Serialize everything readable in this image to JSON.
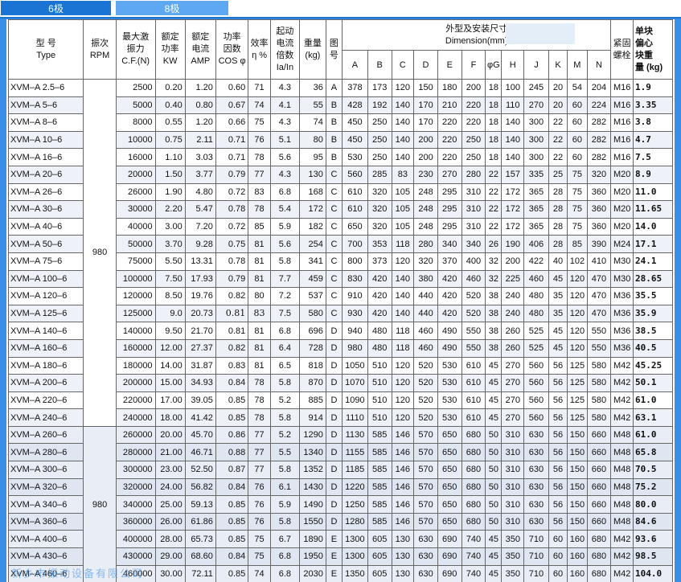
{
  "tabs": [
    {
      "label": "6极"
    },
    {
      "label": "8极"
    }
  ],
  "headers": {
    "type": "型 号\nType",
    "rpm": "振次\nRPM",
    "force": "最大激\n振力\nC.F.(N)",
    "power": "额定\n功率\nKW",
    "current": "额定\n电流\nAMP",
    "cos": "功率\n因数\nCOS φ",
    "eff": "效率\nη %",
    "start": "起动\n电流\n倍数\nIa/In",
    "weight": "重量\n(kg)",
    "fig": "图\n号",
    "dim_title": "外型及安装尺寸\nDimension(mm)",
    "dims": [
      "A",
      "B",
      "C",
      "D",
      "E",
      "F",
      "φG",
      "H",
      "J",
      "K",
      "M",
      "N"
    ],
    "bolt": "紧固\n螺栓",
    "unit_weight": "单块\n偏心\n块重\n量 (kg)"
  },
  "rpm_value": "980",
  "rows": [
    {
      "type": "XVM–A   2.5–6",
      "force": "2500",
      "power": "0.20",
      "current": "1.20",
      "cos": "0.60",
      "eff": "71",
      "start": "4.3",
      "weight": "36",
      "fig": "A",
      "dims": [
        "378",
        "173",
        "120",
        "150",
        "180",
        "200",
        "18",
        "100",
        "245",
        "20",
        "54",
        "204"
      ],
      "bolt": "M16",
      "w": "1.9"
    },
    {
      "type": "XVM–A     5–6",
      "force": "5000",
      "power": "0.40",
      "current": "0.80",
      "cos": "0.67",
      "eff": "74",
      "start": "4.1",
      "weight": "55",
      "fig": "B",
      "dims": [
        "428",
        "192",
        "140",
        "170",
        "210",
        "220",
        "18",
        "110",
        "270",
        "20",
        "60",
        "224"
      ],
      "bolt": "M16",
      "w": "3.35"
    },
    {
      "type": "XVM–A     8–6",
      "force": "8000",
      "power": "0.55",
      "current": "1.20",
      "cos": "0.66",
      "eff": "75",
      "start": "4.3",
      "weight": "74",
      "fig": "B",
      "dims": [
        "450",
        "250",
        "140",
        "170",
        "220",
        "220",
        "18",
        "140",
        "300",
        "22",
        "60",
        "282"
      ],
      "bolt": "M16",
      "w": "3.8"
    },
    {
      "type": "XVM–A    10–6",
      "force": "10000",
      "power": "0.75",
      "current": "2.11",
      "cos": "0.71",
      "eff": "76",
      "start": "5.1",
      "weight": "80",
      "fig": "B",
      "dims": [
        "450",
        "250",
        "140",
        "200",
        "220",
        "250",
        "18",
        "140",
        "300",
        "22",
        "60",
        "282"
      ],
      "bolt": "M16",
      "w": "4.7"
    },
    {
      "type": "XVM–A    16–6",
      "force": "16000",
      "power": "1.10",
      "current": "3.03",
      "cos": "0.71",
      "eff": "78",
      "start": "5.6",
      "weight": "95",
      "fig": "B",
      "dims": [
        "530",
        "250",
        "140",
        "200",
        "220",
        "250",
        "18",
        "140",
        "300",
        "22",
        "60",
        "282"
      ],
      "bolt": "M16",
      "w": "7.5"
    },
    {
      "type": "XVM–A    20–6",
      "force": "20000",
      "power": "1.50",
      "current": "3.77",
      "cos": "0.79",
      "eff": "77",
      "start": "4.3",
      "weight": "130",
      "fig": "C",
      "dims": [
        "560",
        "285",
        "83",
        "230",
        "270",
        "280",
        "22",
        "157",
        "335",
        "25",
        "75",
        "320"
      ],
      "bolt": "M20",
      "w": "8.9"
    },
    {
      "type": "XVM–A    26–6",
      "force": "26000",
      "power": "1.90",
      "current": "4.80",
      "cos": "0.72",
      "eff": "83",
      "start": "6.8",
      "weight": "168",
      "fig": "C",
      "dims": [
        "610",
        "320",
        "105",
        "248",
        "295",
        "310",
        "22",
        "172",
        "365",
        "28",
        "75",
        "360"
      ],
      "bolt": "M20",
      "w": "11.0"
    },
    {
      "type": "XVM–A    30–6",
      "force": "30000",
      "power": "2.20",
      "current": "5.47",
      "cos": "0.78",
      "eff": "78",
      "start": "5.4",
      "weight": "172",
      "fig": "C",
      "dims": [
        "610",
        "320",
        "105",
        "248",
        "295",
        "310",
        "22",
        "172",
        "365",
        "28",
        "75",
        "360"
      ],
      "bolt": "M20",
      "w": "11.65"
    },
    {
      "type": "XVM–A    40–6",
      "force": "40000",
      "power": "3.00",
      "current": "7.20",
      "cos": "0.72",
      "eff": "85",
      "start": "5.9",
      "weight": "182",
      "fig": "C",
      "dims": [
        "650",
        "320",
        "105",
        "248",
        "295",
        "310",
        "22",
        "172",
        "365",
        "28",
        "75",
        "360"
      ],
      "bolt": "M20",
      "w": "14.0"
    },
    {
      "type": "XVM–A    50–6",
      "force": "50000",
      "power": "3.70",
      "current": "9.28",
      "cos": "0.75",
      "eff": "81",
      "start": "5.6",
      "weight": "254",
      "fig": "C",
      "dims": [
        "700",
        "353",
        "118",
        "280",
        "340",
        "340",
        "26",
        "190",
        "406",
        "28",
        "85",
        "390"
      ],
      "bolt": "M24",
      "w": "17.1"
    },
    {
      "type": "XVM–A    75–6",
      "force": "75000",
      "power": "5.50",
      "current": "13.31",
      "cos": "0.78",
      "eff": "81",
      "start": "5.8",
      "weight": "341",
      "fig": "C",
      "dims": [
        "800",
        "373",
        "120",
        "320",
        "370",
        "400",
        "32",
        "200",
        "422",
        "40",
        "102",
        "410"
      ],
      "bolt": "M30",
      "w": "24.1"
    },
    {
      "type": "XVM–A   100–6",
      "force": "100000",
      "power": "7.50",
      "current": "17.93",
      "cos": "0.79",
      "eff": "81",
      "start": "7.7",
      "weight": "459",
      "fig": "C",
      "dims": [
        "830",
        "420",
        "140",
        "380",
        "420",
        "460",
        "32",
        "225",
        "460",
        "45",
        "120",
        "470"
      ],
      "bolt": "M30",
      "w": "28.65"
    },
    {
      "type": "XVM–A   120–6",
      "force": "120000",
      "power": "8.50",
      "current": "19.76",
      "cos": "0.82",
      "eff": "80",
      "start": "7.2",
      "weight": "537",
      "fig": "C",
      "dims": [
        "910",
        "420",
        "140",
        "440",
        "420",
        "520",
        "38",
        "240",
        "480",
        "35",
        "120",
        "470"
      ],
      "bolt": "M36",
      "w": "35.5"
    },
    {
      "type": "XVM–A   125–6",
      "force": "125000",
      "power": "9.0",
      "current": "20.73",
      "cos": "0.81",
      "eff": "83",
      "start": "7.5",
      "weight": "580",
      "fig": "C",
      "dims": [
        "930",
        "420",
        "140",
        "440",
        "420",
        "520",
        "38",
        "240",
        "480",
        "35",
        "120",
        "470"
      ],
      "bolt": "M36",
      "w": "35.9",
      "serif": true
    },
    {
      "type": "XVM–A   140–6",
      "force": "140000",
      "power": "9.50",
      "current": "21.70",
      "cos": "0.81",
      "eff": "81",
      "start": "6.8",
      "weight": "696",
      "fig": "D",
      "dims": [
        "940",
        "480",
        "118",
        "460",
        "490",
        "550",
        "38",
        "260",
        "525",
        "45",
        "120",
        "550"
      ],
      "bolt": "M36",
      "w": "38.5"
    },
    {
      "type": "XVM–A   160–6",
      "force": "160000",
      "power": "12.00",
      "current": "27.37",
      "cos": "0.82",
      "eff": "81",
      "start": "6.4",
      "weight": "728",
      "fig": "D",
      "dims": [
        "980",
        "480",
        "118",
        "460",
        "490",
        "550",
        "38",
        "260",
        "525",
        "45",
        "120",
        "550"
      ],
      "bolt": "M36",
      "w": "40.5"
    },
    {
      "type": "XVM–A   180–6",
      "force": "180000",
      "power": "14.00",
      "current": "31.87",
      "cos": "0.83",
      "eff": "81",
      "start": "6.5",
      "weight": "818",
      "fig": "D",
      "dims": [
        "1050",
        "510",
        "120",
        "520",
        "530",
        "610",
        "45",
        "270",
        "560",
        "56",
        "125",
        "580"
      ],
      "bolt": "M42",
      "w": "45.25"
    },
    {
      "type": "XVM–A   200–6",
      "force": "200000",
      "power": "15.00",
      "current": "34.93",
      "cos": "0.84",
      "eff": "78",
      "start": "5.8",
      "weight": "870",
      "fig": "D",
      "dims": [
        "1070",
        "510",
        "120",
        "520",
        "530",
        "610",
        "45",
        "270",
        "560",
        "56",
        "125",
        "580"
      ],
      "bolt": "M42",
      "w": "50.1"
    },
    {
      "type": "XVM–A   220–6",
      "force": "220000",
      "power": "17.00",
      "current": "39.05",
      "cos": "0.85",
      "eff": "78",
      "start": "5.2",
      "weight": "885",
      "fig": "D",
      "dims": [
        "1090",
        "510",
        "120",
        "520",
        "530",
        "610",
        "45",
        "270",
        "560",
        "56",
        "125",
        "580"
      ],
      "bolt": "M42",
      "w": "61.0"
    },
    {
      "type": "XVM–A   240–6",
      "force": "240000",
      "power": "18.00",
      "current": "41.42",
      "cos": "0.85",
      "eff": "78",
      "start": "5.8",
      "weight": "914",
      "fig": "D",
      "dims": [
        "1110",
        "510",
        "120",
        "520",
        "530",
        "610",
        "45",
        "270",
        "560",
        "56",
        "125",
        "580"
      ],
      "bolt": "M42",
      "w": "63.1"
    },
    {
      "type": "XVM–A   260–6",
      "force": "260000",
      "power": "20.00",
      "current": "45.70",
      "cos": "0.86",
      "eff": "77",
      "start": "5.2",
      "weight": "1290",
      "fig": "D",
      "dims": [
        "1130",
        "585",
        "146",
        "570",
        "650",
        "680",
        "50",
        "310",
        "630",
        "56",
        "150",
        "660"
      ],
      "bolt": "M48",
      "w": "61.0"
    },
    {
      "type": "XVM–A   280–6",
      "force": "280000",
      "power": "21.00",
      "current": "46.71",
      "cos": "0.88",
      "eff": "77",
      "start": "5.5",
      "weight": "1340",
      "fig": "D",
      "dims": [
        "1155",
        "585",
        "146",
        "570",
        "650",
        "680",
        "50",
        "310",
        "630",
        "56",
        "150",
        "660"
      ],
      "bolt": "M48",
      "w": "65.8"
    },
    {
      "type": "XVM–A   300–6",
      "force": "300000",
      "power": "23.00",
      "current": "52.50",
      "cos": "0.87",
      "eff": "77",
      "start": "5.8",
      "weight": "1352",
      "fig": "D",
      "dims": [
        "1185",
        "585",
        "146",
        "570",
        "650",
        "680",
        "50",
        "310",
        "630",
        "56",
        "150",
        "660"
      ],
      "bolt": "M48",
      "w": "70.5"
    },
    {
      "type": "XVM–A   320–6",
      "force": "320000",
      "power": "24.00",
      "current": "56.82",
      "cos": "0.84",
      "eff": "76",
      "start": "6.1",
      "weight": "1430",
      "fig": "D",
      "dims": [
        "1220",
        "585",
        "146",
        "570",
        "650",
        "680",
        "50",
        "310",
        "630",
        "56",
        "150",
        "660"
      ],
      "bolt": "M48",
      "w": "75.2"
    },
    {
      "type": "XVM–A   340–6",
      "force": "340000",
      "power": "25.00",
      "current": "59.13",
      "cos": "0.85",
      "eff": "76",
      "start": "5.9",
      "weight": "1490",
      "fig": "D",
      "dims": [
        "1250",
        "585",
        "146",
        "570",
        "650",
        "680",
        "50",
        "310",
        "630",
        "56",
        "150",
        "660"
      ],
      "bolt": "M48",
      "w": "80.0"
    },
    {
      "type": "XVM–A   360–6",
      "force": "360000",
      "power": "26.00",
      "current": "61.86",
      "cos": "0.85",
      "eff": "76",
      "start": "5.8",
      "weight": "1550",
      "fig": "D",
      "dims": [
        "1280",
        "585",
        "146",
        "570",
        "650",
        "680",
        "50",
        "310",
        "630",
        "56",
        "150",
        "660"
      ],
      "bolt": "M48",
      "w": "84.6"
    },
    {
      "type": "XVM–A   400–6",
      "force": "400000",
      "power": "28.00",
      "current": "65.73",
      "cos": "0.85",
      "eff": "75",
      "start": "6.7",
      "weight": "1890",
      "fig": "E",
      "dims": [
        "1300",
        "605",
        "130",
        "630",
        "690",
        "740",
        "45",
        "350",
        "710",
        "60",
        "160",
        "680"
      ],
      "bolt": "M42",
      "w": "93.6"
    },
    {
      "type": "XVM–A   430–6",
      "force": "430000",
      "power": "29.00",
      "current": "68.60",
      "cos": "0.84",
      "eff": "75",
      "start": "6.8",
      "weight": "1950",
      "fig": "E",
      "dims": [
        "1300",
        "605",
        "130",
        "630",
        "690",
        "740",
        "45",
        "350",
        "710",
        "60",
        "160",
        "680"
      ],
      "bolt": "M42",
      "w": "98.5"
    },
    {
      "type": "XVM–A   460–6",
      "force": "460000",
      "power": "30.00",
      "current": "72.11",
      "cos": "0.85",
      "eff": "74",
      "start": "6.8",
      "weight": "2030",
      "fig": "E",
      "dims": [
        "1350",
        "605",
        "130",
        "630",
        "690",
        "740",
        "45",
        "350",
        "710",
        "60",
        "160",
        "680"
      ],
      "bolt": "M42",
      "w": "104.0"
    }
  ],
  "watermark": "新乡市振动设备有限公司"
}
